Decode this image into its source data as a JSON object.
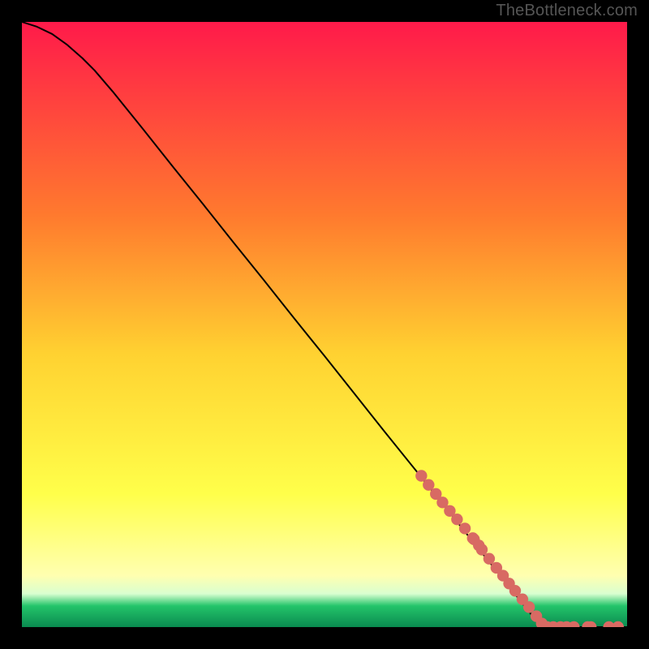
{
  "watermark": "TheBottleneck.com",
  "colors": {
    "bg": "#000000",
    "curve": "#000000",
    "marker_fill": "#d86a63",
    "marker_stroke": "#d86a63",
    "grad_top": "#ff1a4a",
    "grad_mid_upper": "#ff7a2e",
    "grad_mid": "#ffd231",
    "grad_mid_lower": "#ffff4a",
    "grad_baseline_glow": "#ffffb0",
    "grad_green_top": "#d9ffd0",
    "grad_green": "#23c46a",
    "grad_green_dark": "#0a8a50"
  },
  "chart_data": {
    "type": "line",
    "title": "",
    "xlabel": "",
    "ylabel": "",
    "xlim": [
      0,
      1
    ],
    "ylim": [
      0,
      1
    ],
    "series": [
      {
        "name": "curve",
        "x": [
          0.0,
          0.025,
          0.05,
          0.075,
          0.1,
          0.12,
          0.15,
          0.2,
          0.25,
          0.3,
          0.35,
          0.4,
          0.45,
          0.5,
          0.55,
          0.6,
          0.65,
          0.7,
          0.75,
          0.78,
          0.8,
          0.82,
          0.84,
          0.855,
          0.86,
          0.88,
          0.9,
          0.93,
          0.96,
          1.0
        ],
        "y": [
          1.0,
          0.992,
          0.98,
          0.962,
          0.94,
          0.92,
          0.885,
          0.823,
          0.76,
          0.698,
          0.635,
          0.573,
          0.51,
          0.448,
          0.385,
          0.322,
          0.26,
          0.198,
          0.135,
          0.098,
          0.073,
          0.048,
          0.023,
          0.004,
          0.0,
          0.0,
          0.0,
          0.0,
          0.0,
          0.0
        ]
      }
    ],
    "markers": {
      "name": "highlight-dots",
      "x": [
        0.66,
        0.672,
        0.684,
        0.695,
        0.707,
        0.719,
        0.732,
        0.745,
        0.747,
        0.755,
        0.76,
        0.772,
        0.784,
        0.795,
        0.805,
        0.815,
        0.827,
        0.838,
        0.85,
        0.859,
        0.868,
        0.878,
        0.89,
        0.9,
        0.912,
        0.935,
        0.94,
        0.97,
        0.985
      ],
      "y": [
        0.25,
        0.235,
        0.22,
        0.206,
        0.192,
        0.178,
        0.163,
        0.147,
        0.145,
        0.135,
        0.128,
        0.113,
        0.098,
        0.085,
        0.072,
        0.06,
        0.046,
        0.033,
        0.018,
        0.006,
        0.0,
        0.0,
        0.0,
        0.0,
        0.0,
        0.0,
        0.0,
        0.0,
        0.0
      ]
    },
    "gradient_stops": [
      {
        "pos": 0.0,
        "key": "grad_top"
      },
      {
        "pos": 0.32,
        "key": "grad_mid_upper"
      },
      {
        "pos": 0.55,
        "key": "grad_mid"
      },
      {
        "pos": 0.78,
        "key": "grad_mid_lower"
      },
      {
        "pos": 0.915,
        "key": "grad_baseline_glow"
      },
      {
        "pos": 0.945,
        "key": "grad_green_top"
      },
      {
        "pos": 0.965,
        "key": "grad_green"
      },
      {
        "pos": 1.0,
        "key": "grad_green_dark"
      }
    ]
  }
}
